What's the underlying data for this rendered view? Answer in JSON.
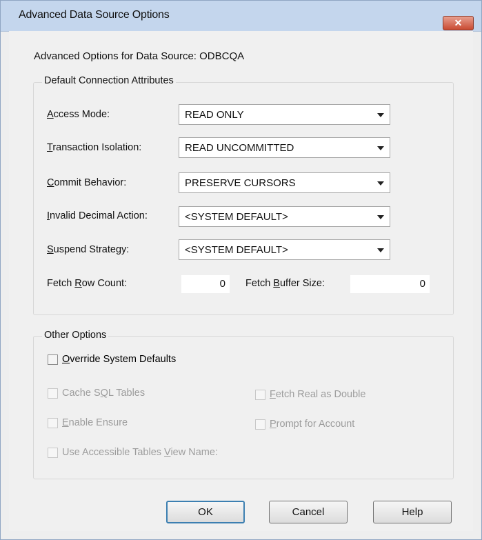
{
  "window": {
    "title": "Advanced Data Source Options",
    "close_label": "✕"
  },
  "header": {
    "subtitle": "Advanced Options for Data Source: ODBCQA"
  },
  "default_group": {
    "title": "Default Connection Attributes",
    "fields": [
      {
        "label_u": "A",
        "label_rest": "ccess Mode:",
        "value": "READ ONLY"
      },
      {
        "label_u": "T",
        "label_rest": "ransaction Isolation:",
        "value": "READ UNCOMMITTED"
      },
      {
        "label_u": "C",
        "label_rest": "ommit Behavior:",
        "value": "PRESERVE CURSORS"
      },
      {
        "label_u": "I",
        "label_rest": "nvalid Decimal Action:",
        "value": "<SYSTEM DEFAULT>"
      },
      {
        "label_u": "S",
        "label_rest": "uspend Strategy:",
        "value": "<SYSTEM DEFAULT>"
      }
    ],
    "fetch_row": {
      "label_pre": "Fetch ",
      "label_u": "R",
      "label_rest": "ow Count:",
      "value": "0"
    },
    "fetch_buffer": {
      "label_pre": "Fetch ",
      "label_u": "B",
      "label_rest": "uffer Size:",
      "value": "0"
    }
  },
  "other_group": {
    "title": "Other Options",
    "override": {
      "label_u": "O",
      "label_rest": "verride System Defaults"
    },
    "cache_sql": {
      "label_pre": "Cache S",
      "label_u": "Q",
      "label_rest": "L Tables"
    },
    "fetch_real": {
      "label_u": "F",
      "label_rest": "etch Real as Double"
    },
    "enable_ensure": {
      "label_u": "E",
      "label_rest": "nable Ensure"
    },
    "prompt_account": {
      "label_u": "P",
      "label_rest": "rompt for Account"
    },
    "use_accessible": {
      "label_pre": "Use Accessible Tables ",
      "label_u": "V",
      "label_rest": "iew Name:"
    }
  },
  "buttons": {
    "ok": "OK",
    "cancel": "Cancel",
    "help": "Help"
  }
}
